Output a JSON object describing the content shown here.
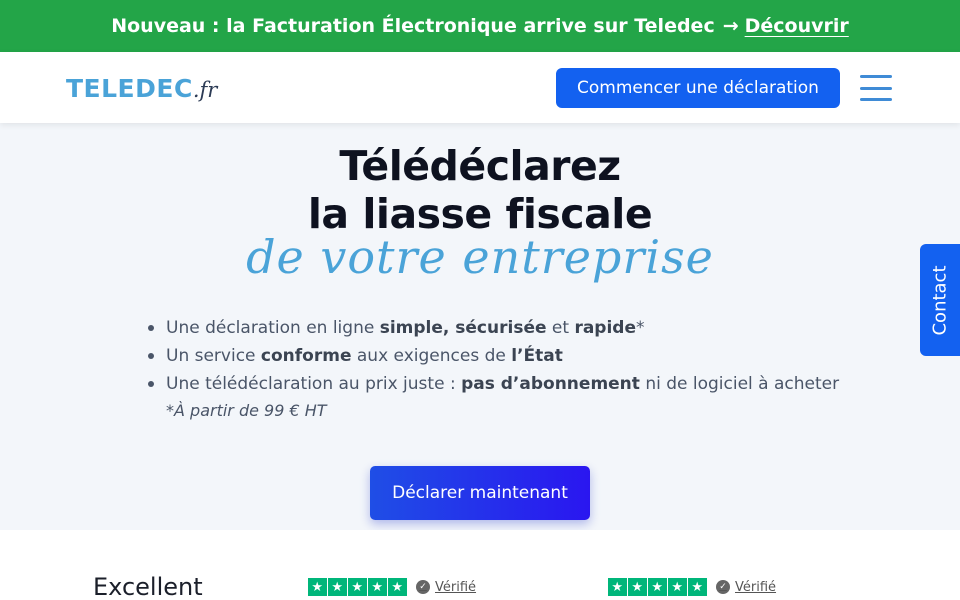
{
  "banner": {
    "text": "Nouveau : la Facturation Électronique arrive sur Teledec",
    "arrow": "→",
    "link": "Découvrir"
  },
  "header": {
    "logo_main": "TELEDEC",
    "logo_tld": ".fr",
    "cta": "Commencer une déclaration",
    "menu_icon": "hamburger-icon"
  },
  "hero": {
    "title_line1": "Télédéclarez",
    "title_line2": "la liasse fiscale",
    "subtitle": "de votre entreprise",
    "bullets": [
      {
        "a": "Une déclaration en ligne ",
        "b1": "simple, sécurisée",
        "c": " et ",
        "b2": "rapide",
        "d": "*"
      },
      {
        "a": "Un service ",
        "b1": "conforme",
        "c": " aux exigences de ",
        "b2": "l’État",
        "d": ""
      },
      {
        "a": "Une télédéclaration au prix juste : ",
        "b1": "pas d’abonnement",
        "c": " ni de logiciel à acheter",
        "b2": "",
        "d": ""
      }
    ],
    "note": "*À partir de 99 € HT",
    "cta": "Déclarer maintenant"
  },
  "contact_tab": "Contact",
  "reviews": {
    "rating_label": "Excellent",
    "items": [
      {
        "verified": "Vérifié"
      },
      {
        "verified": "Vérifié"
      }
    ],
    "star_color": "#00b67a"
  },
  "colors": {
    "banner": "#23a548",
    "primary": "#1361f0",
    "accent": "#4aa3d8"
  }
}
